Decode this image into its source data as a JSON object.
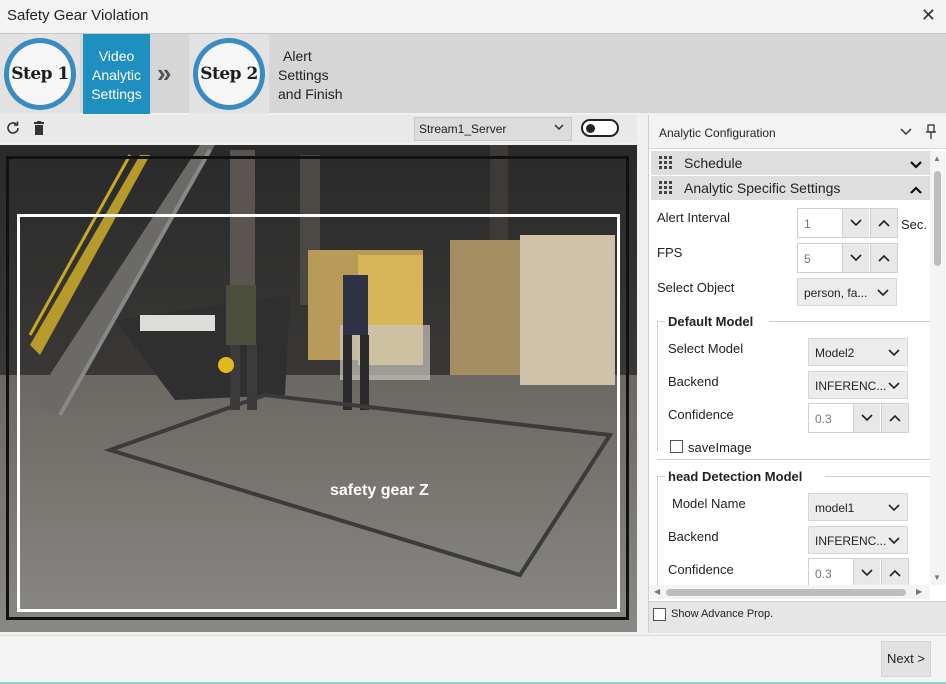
{
  "window": {
    "title": "Safety Gear Violation",
    "close_glyph": "✕"
  },
  "steps": {
    "step1_badge": "Step 1",
    "step1_label": [
      "Video",
      "Analytic",
      "Settings"
    ],
    "separator_glyph": "»",
    "step2_badge": "Step 2",
    "step2_label": [
      "Alert",
      "Settings",
      "and Finish"
    ],
    "active_color": "#1f8fc0"
  },
  "video_toolbar": {
    "refresh_icon": "refresh-icon",
    "delete_icon": "trash-icon",
    "stream": "Stream1_Server",
    "toggle_on": false
  },
  "video": {
    "zone_label": "safety gear Z"
  },
  "panel": {
    "title": "Analytic Configuration",
    "sections": {
      "schedule": "Schedule",
      "analytic_specific": "Analytic Specific Settings"
    },
    "alert_interval": {
      "label": "Alert Interval",
      "value": "1",
      "unit": "Sec."
    },
    "fps": {
      "label": "FPS",
      "value": "5"
    },
    "select_object": {
      "label": "Select Object",
      "value": "person, fa..."
    },
    "default_model": {
      "title": "Default Model",
      "select_model_label": "Select Model",
      "select_model_value": "Model2",
      "backend_label": "Backend",
      "backend_value": "INFERENC...",
      "confidence_label": "Confidence",
      "confidence_value": "0.3",
      "save_image_label": "saveImage"
    },
    "head_model": {
      "title": "head Detection Model",
      "model_name_label": "Model Name",
      "model_name_value": "model1",
      "backend_label": "Backend",
      "backend_value": "INFERENC...",
      "confidence_label": "Confidence",
      "confidence_value": "0.3"
    },
    "advance_label": "Show Advance Prop."
  },
  "footer": {
    "next_label": "Next >"
  }
}
